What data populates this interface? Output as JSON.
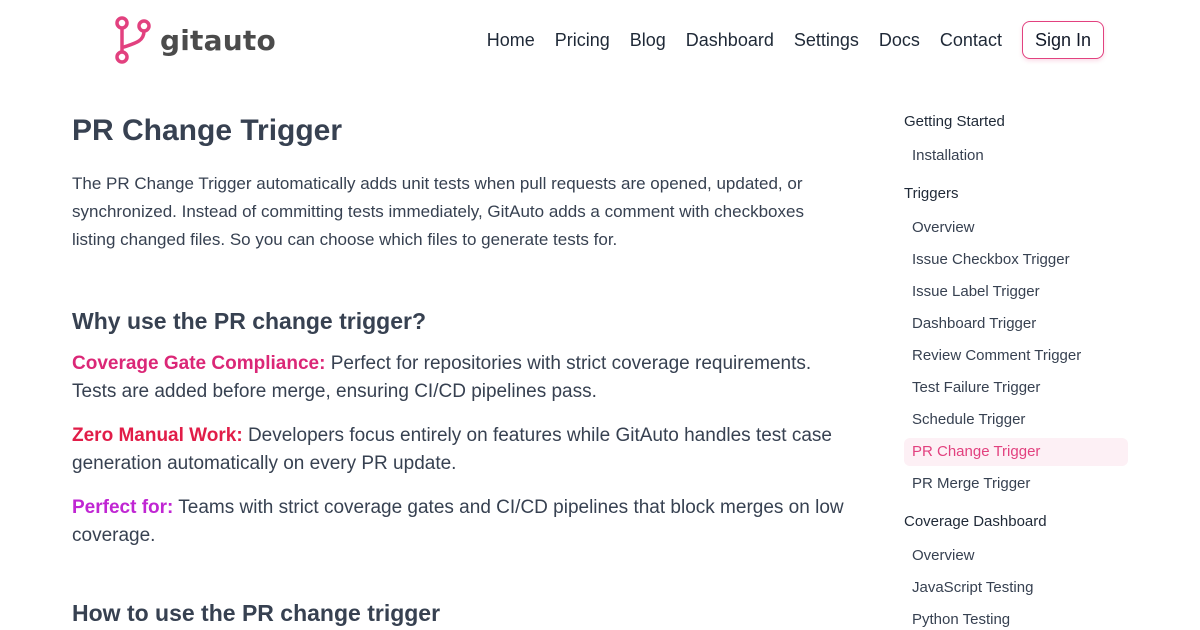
{
  "brand": {
    "name": "gitauto",
    "accent": "#e2417f"
  },
  "nav": {
    "links": [
      "Home",
      "Pricing",
      "Blog",
      "Dashboard",
      "Settings",
      "Docs",
      "Contact"
    ],
    "sign_in": "Sign In"
  },
  "main": {
    "title": "PR Change Trigger",
    "intro": "The PR Change Trigger automatically adds unit tests when pull requests are opened, updated, or synchronized. Instead of committing tests immediately, GitAuto adds a comment with checkboxes listing changed files. So you can choose which files to generate tests for.",
    "why_heading": "Why use the PR change trigger?",
    "benefits": [
      {
        "label": "Coverage Gate Compliance:",
        "text": " Perfect for repositories with strict coverage requirements. Tests are added before merge, ensuring CI/CD pipelines pass.",
        "color": "#db2777"
      },
      {
        "label": "Zero Manual Work:",
        "text": " Developers focus entirely on features while GitAuto handles test case generation automatically on every PR update.",
        "color": "#e11d48"
      },
      {
        "label": "Perfect for:",
        "text": " Teams with strict coverage gates and CI/CD pipelines that block merges on low coverage.",
        "color": "#c026d3"
      }
    ],
    "how_heading": "How to use the PR change trigger"
  },
  "sidebar": {
    "groups": [
      {
        "title": "Getting Started",
        "items": [
          "Installation"
        ]
      },
      {
        "title": "Triggers",
        "items": [
          "Overview",
          "Issue Checkbox Trigger",
          "Issue Label Trigger",
          "Dashboard Trigger",
          "Review Comment Trigger",
          "Test Failure Trigger",
          "Schedule Trigger",
          "PR Change Trigger",
          "PR Merge Trigger"
        ]
      },
      {
        "title": "Coverage Dashboard",
        "items": [
          "Overview",
          "JavaScript Testing",
          "Python Testing"
        ]
      }
    ],
    "active_item": "PR Change Trigger"
  }
}
